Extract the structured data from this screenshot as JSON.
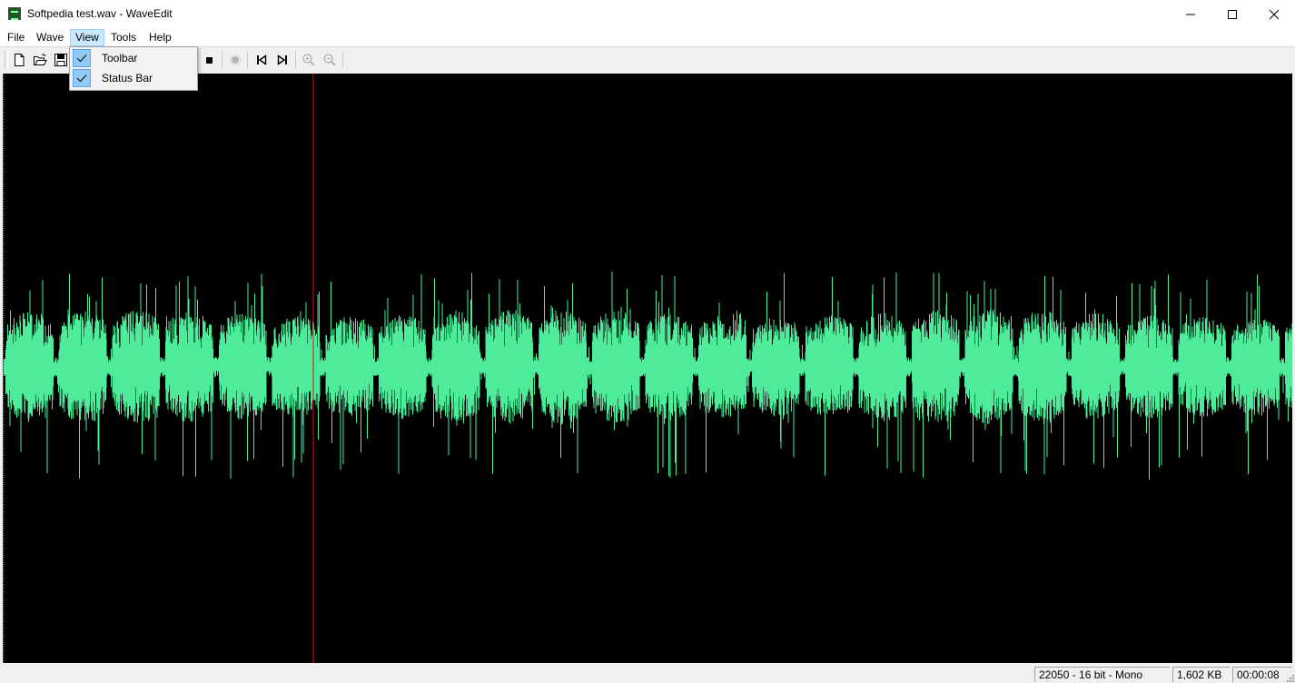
{
  "window": {
    "title": "Softpedia test.wav - WaveEdit",
    "controls": [
      "minimize-icon",
      "maximize-icon",
      "close-icon"
    ]
  },
  "menubar": {
    "items": [
      {
        "label": "File"
      },
      {
        "label": "Wave"
      },
      {
        "label": "View",
        "active": true
      },
      {
        "label": "Tools"
      },
      {
        "label": "Help"
      }
    ]
  },
  "toolbar": {
    "buttons": [
      {
        "icon": "new-file-icon"
      },
      {
        "icon": "open-folder-icon"
      },
      {
        "icon": "save-icon"
      },
      {
        "icon": "stop-icon"
      },
      {
        "icon": "record-icon",
        "enabled": false
      },
      {
        "icon": "skip-to-start-icon"
      },
      {
        "icon": "skip-to-end-icon"
      },
      {
        "icon": "zoom-in-icon",
        "enabled": false
      },
      {
        "icon": "zoom-out-icon",
        "enabled": false
      }
    ]
  },
  "view_menu": {
    "items": [
      {
        "label": "Toolbar",
        "checked": true
      },
      {
        "label": "Status Bar",
        "checked": true
      }
    ]
  },
  "waveform": {
    "background_color": "#000000",
    "wave_color": "#4deb9a",
    "cursor_color": "#e01010"
  },
  "statusbar": {
    "format": "22050 - 16 bit - Mono",
    "size": "1,602 KB",
    "time": "00:00:08"
  }
}
